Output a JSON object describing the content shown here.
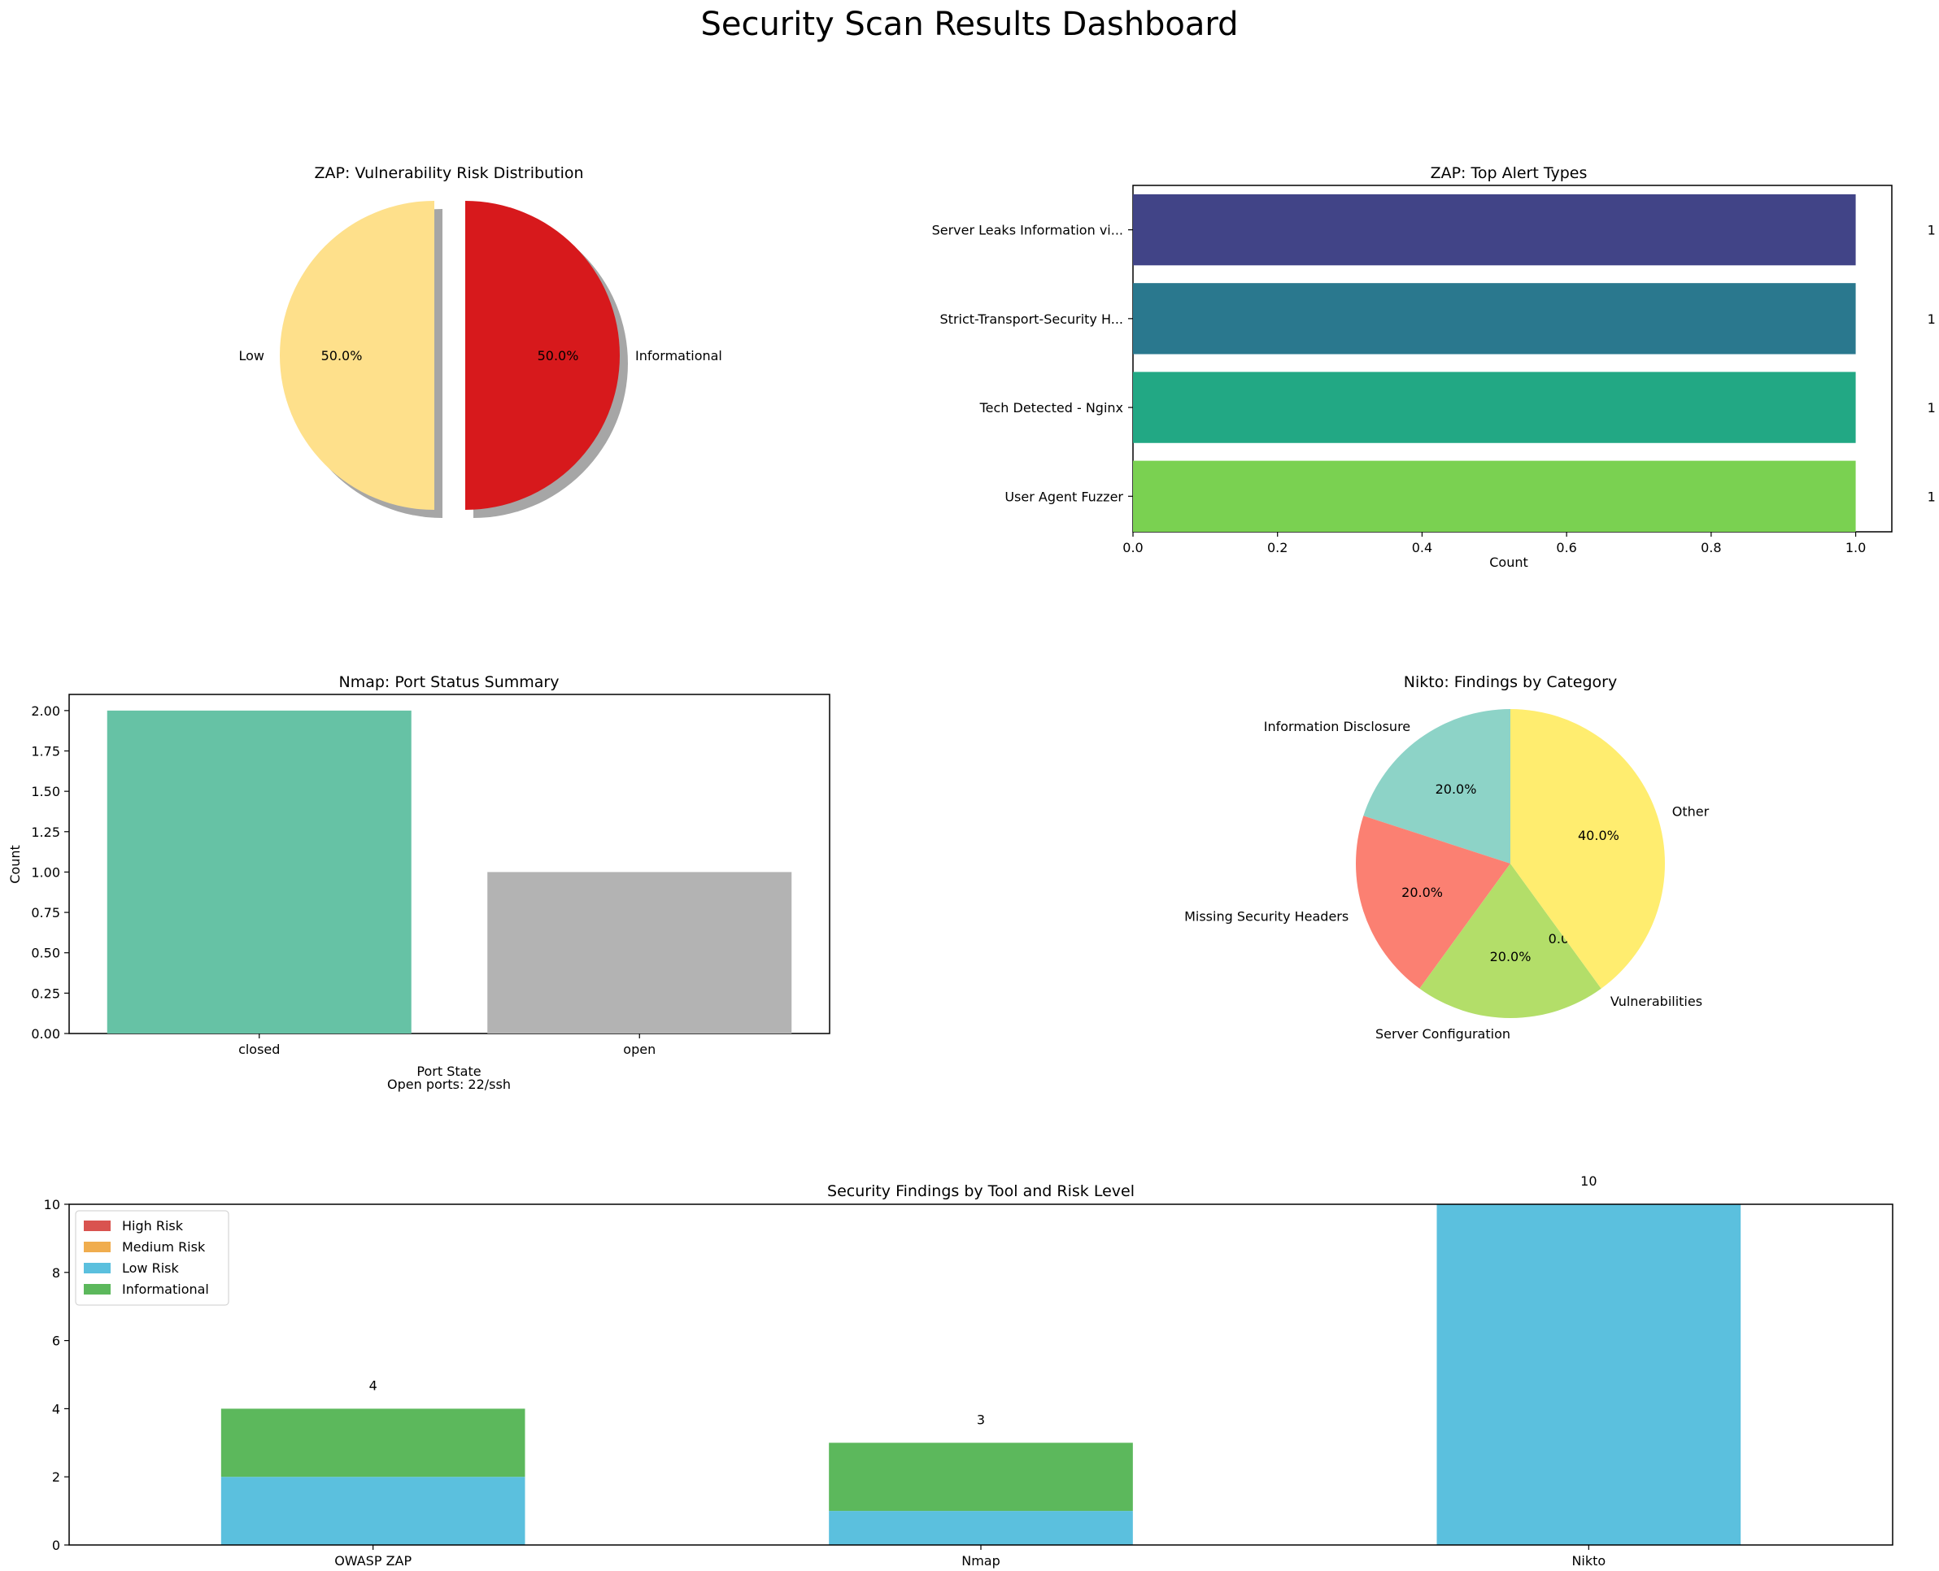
{
  "title": "Security Scan Results Dashboard",
  "chart_data": [
    {
      "id": "zap_risk",
      "type": "pie",
      "title": "ZAP: Vulnerability Risk Distribution",
      "labels": [
        "Low",
        "Informational"
      ],
      "values": [
        50.0,
        50.0
      ],
      "pct_labels": [
        "50.0%",
        "50.0%"
      ],
      "colors": [
        "#fee08b",
        "#d7191c"
      ],
      "exploded": true,
      "shadow": true
    },
    {
      "id": "zap_alerts",
      "type": "bar",
      "orientation": "horizontal",
      "title": "ZAP: Top Alert Types",
      "categories": [
        "Server Leaks Information vi...",
        "Strict-Transport-Security H...",
        "Tech Detected - Nginx",
        "User Agent Fuzzer"
      ],
      "values": [
        1,
        1,
        1,
        1
      ],
      "value_labels": [
        "1",
        "1",
        "1",
        "1"
      ],
      "colors": [
        "#414487",
        "#2a788e",
        "#22a884",
        "#7ad151"
      ],
      "xlabel": "Count",
      "xlim": [
        0,
        1.05
      ],
      "xticks": [
        "0.0",
        "0.2",
        "0.4",
        "0.6",
        "0.8",
        "1.0"
      ]
    },
    {
      "id": "nmap_ports",
      "type": "bar",
      "title": "Nmap: Port Status Summary",
      "categories": [
        "closed",
        "open"
      ],
      "values": [
        2,
        1
      ],
      "colors": [
        "#66c2a5",
        "#b3b3b3"
      ],
      "xlabel": "Port State",
      "ylabel": "Count",
      "ylim": [
        0,
        2.1
      ],
      "yticks": [
        "0.00",
        "0.25",
        "0.50",
        "0.75",
        "1.00",
        "1.25",
        "1.50",
        "1.75",
        "2.00"
      ],
      "annotation": "Open ports: 22/ssh"
    },
    {
      "id": "nikto_categories",
      "type": "pie",
      "title": "Nikto: Findings by Category",
      "labels": [
        "Information Disclosure",
        "Missing Security Headers",
        "Server Configuration",
        "Vulnerabilities",
        "Other"
      ],
      "values": [
        20.0,
        20.0,
        20.0,
        0.0,
        40.0
      ],
      "pct_labels": [
        "20.0%",
        "20.0%",
        "20.0%",
        "0.0%",
        "40.0%"
      ],
      "colors": [
        "#8dd3c7",
        "#fb8072",
        "#b3de69",
        "#bebada",
        "#ffed6f"
      ]
    },
    {
      "id": "findings_by_tool",
      "type": "bar",
      "stacked": true,
      "title": "Security Findings by Tool and Risk Level",
      "categories": [
        "OWASP ZAP",
        "Nmap",
        "Nikto"
      ],
      "series": [
        {
          "name": "High Risk",
          "color": "#d9534f",
          "values": [
            0,
            0,
            0
          ]
        },
        {
          "name": "Medium Risk",
          "color": "#f0ad4e",
          "values": [
            0,
            0,
            0
          ]
        },
        {
          "name": "Low Risk",
          "color": "#5bc0de",
          "values": [
            2,
            1,
            10
          ]
        },
        {
          "name": "Informational",
          "color": "#5cb85c",
          "values": [
            2,
            2,
            0
          ]
        }
      ],
      "totals": [
        "4",
        "3",
        "10"
      ],
      "ylim": [
        0,
        10
      ],
      "yticks": [
        "0",
        "2",
        "4",
        "6",
        "8",
        "10"
      ],
      "legend": "top-left"
    }
  ]
}
